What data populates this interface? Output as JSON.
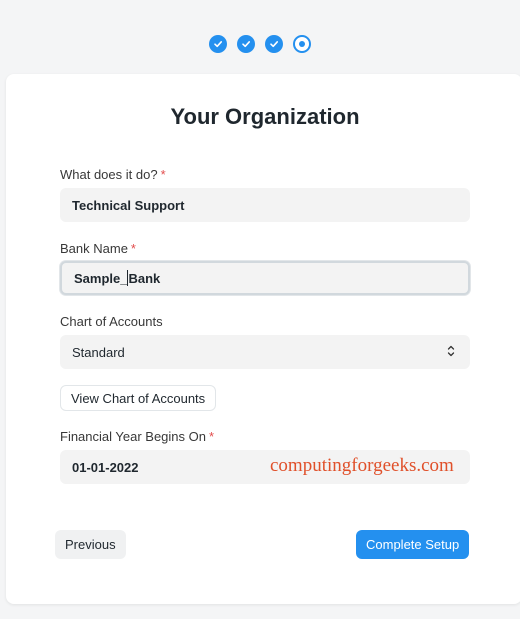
{
  "progress": {
    "steps": [
      {
        "state": "done"
      },
      {
        "state": "done"
      },
      {
        "state": "done"
      },
      {
        "state": "current"
      }
    ],
    "colors": {
      "accent": "#2490ef"
    }
  },
  "form": {
    "title": "Your Organization",
    "what_does_it_do": {
      "label": "What does it do?",
      "required_mark": "*",
      "value": "Technical Support"
    },
    "bank_name": {
      "label": "Bank Name",
      "required_mark": "*",
      "value_before_caret": "Sample_",
      "value_after_caret": "Bank"
    },
    "chart_of_accounts": {
      "label": "Chart of Accounts",
      "value": "Standard"
    },
    "view_chart_button": "View Chart of Accounts",
    "financial_year": {
      "label": "Financial Year Begins On",
      "required_mark": "*",
      "value": "01-01-2022"
    }
  },
  "footer": {
    "previous_label": "Previous",
    "complete_label": "Complete Setup"
  },
  "watermark": "computingforgeeks.com"
}
